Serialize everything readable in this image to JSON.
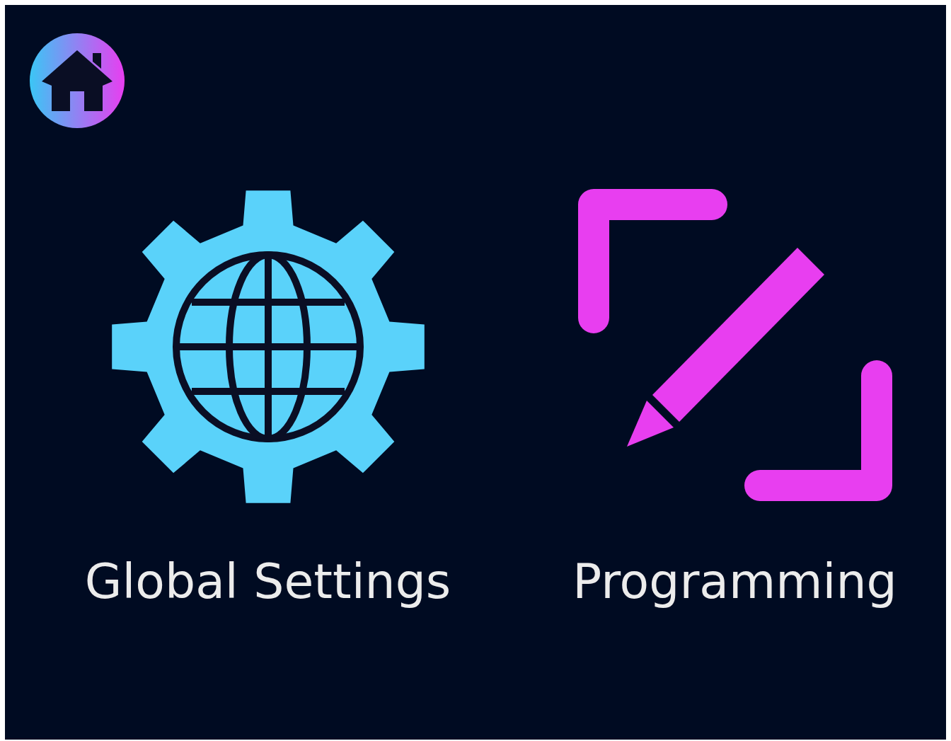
{
  "menu": [
    {
      "label": "Global Settings",
      "kind": "globe-gear"
    },
    {
      "label": "Programming",
      "kind": "pencil"
    }
  ]
}
